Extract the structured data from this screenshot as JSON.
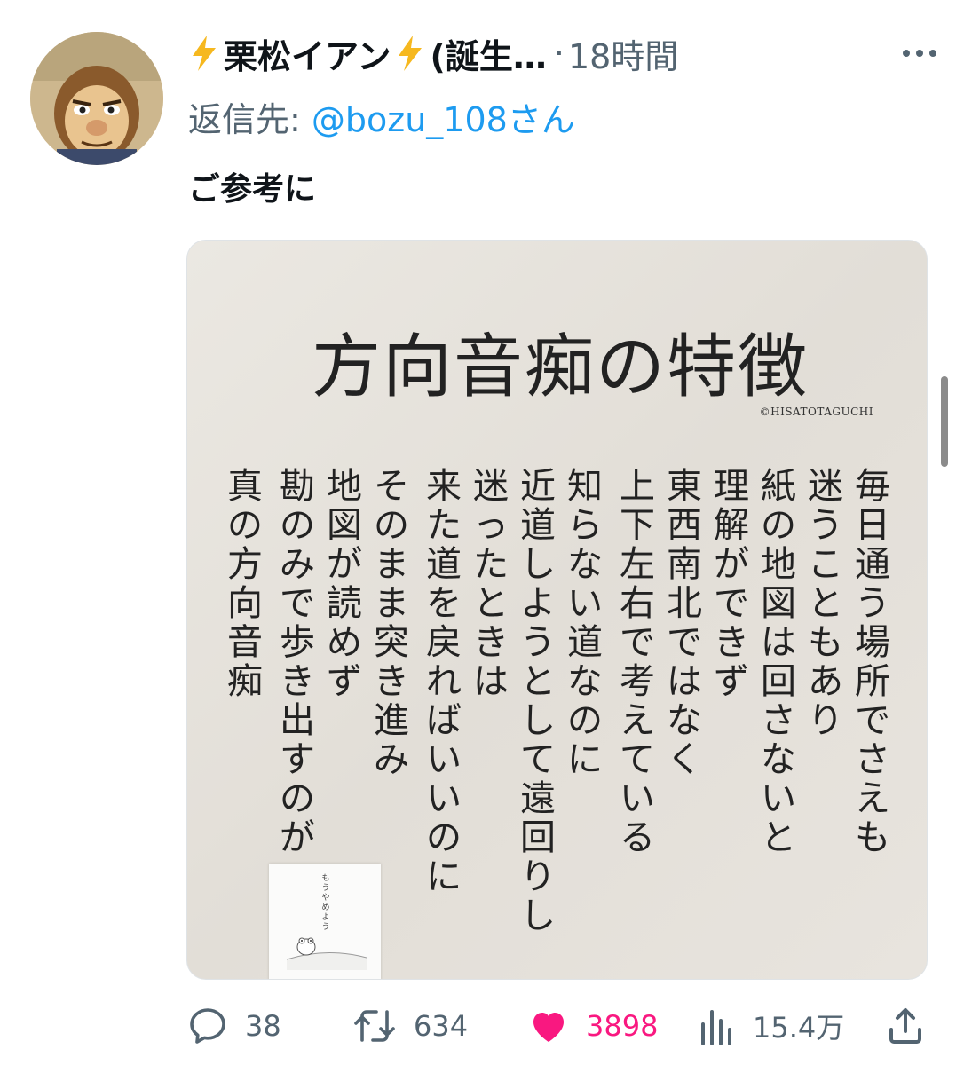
{
  "tweet": {
    "author_name": "栗松イアン",
    "author_suffix": "(誕生…",
    "separator": "·",
    "time": "18時間",
    "reply_prefix": "返信先: ",
    "reply_handle": "@bozu_108さん",
    "text": "ご参考に"
  },
  "media": {
    "title": "方向音痴の特徴",
    "credit": "©HISATOTAGUCHI",
    "columns": [
      "毎日通う場所でさえも",
      "迷うこともあり",
      "紙の地図は回さないと",
      "理解ができず",
      "東西南北ではなく",
      "上下左右で考えている",
      "知らない道なのに",
      "近道しようとして遠回りし",
      "迷ったときは",
      "来た道を戻ればいいのに",
      "そのまま突き進み",
      "地図が読めず",
      "勘のみで歩き出すのが",
      "真の方向音痴"
    ],
    "book_title": "もうやめよう"
  },
  "actions": {
    "replies": "38",
    "retweets": "634",
    "likes": "3898",
    "views": "15.4万"
  },
  "colors": {
    "text": "#0f1419",
    "muted": "#536471",
    "link": "#1d9bf0",
    "like": "#f91880",
    "bolt": "#f6b81f"
  },
  "icons": {
    "reply": "reply-icon",
    "retweet": "retweet-icon",
    "like": "heart-icon",
    "views": "views-icon",
    "share": "share-icon"
  }
}
